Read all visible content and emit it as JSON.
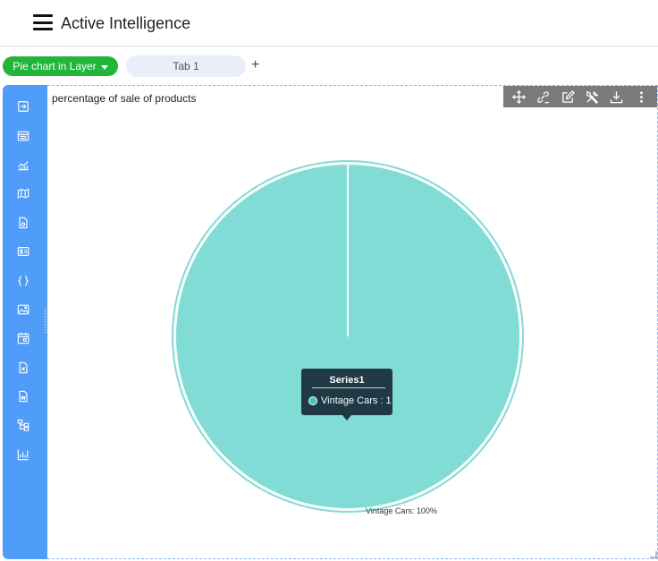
{
  "app": {
    "title": "Active Intelligence"
  },
  "tabs": {
    "layer_button": "Pie chart in Layer",
    "tab1": "Tab 1",
    "add": "+"
  },
  "sidebar": {
    "items": [
      "sign-in-icon",
      "table-icon",
      "line-chart-icon",
      "map-icon",
      "file-icon",
      "id-card-icon",
      "code-braces-icon",
      "image-icon",
      "calendar-icon",
      "excel-icon",
      "word-icon",
      "hierarchy-icon",
      "bar-chart-icon"
    ]
  },
  "toolbar": {
    "tools": [
      "move-icon",
      "link-icon",
      "edit-icon",
      "tools-icon",
      "download-icon",
      "more-vertical-icon"
    ]
  },
  "colors": {
    "sidebar": "#4f9cf9",
    "layer_button": "#22b53a",
    "slice": "#80dcd4",
    "tooltip_bg": "#1f3a45"
  },
  "chart_data": {
    "type": "pie",
    "title": "percentage of sale of products",
    "categories": [
      "Vintage Cars"
    ],
    "values": [
      1
    ],
    "series": [
      {
        "name": "Series1",
        "values": [
          1
        ]
      }
    ],
    "data_labels": [
      "Vintage Cars: 100%"
    ],
    "tooltip": {
      "title": "Series1",
      "text": "Vintage Cars : 1"
    }
  }
}
